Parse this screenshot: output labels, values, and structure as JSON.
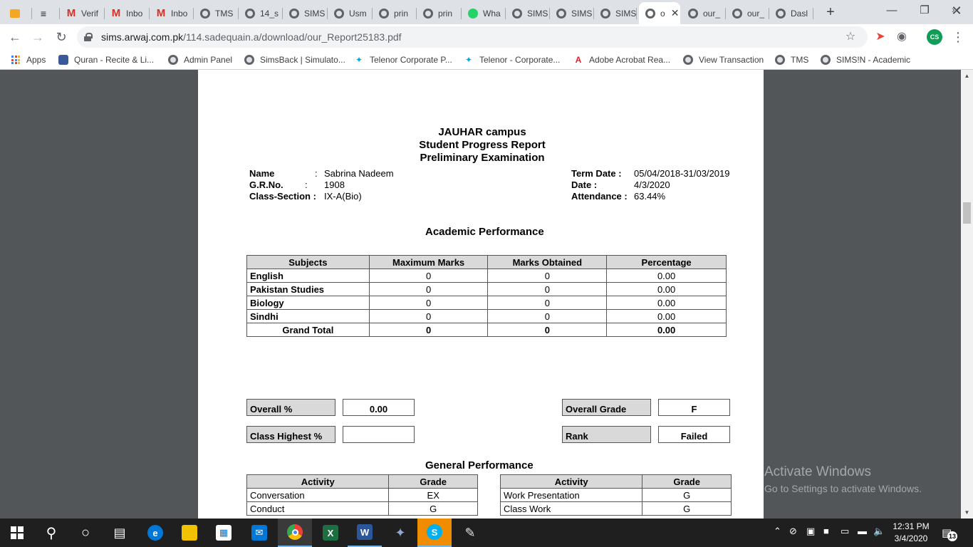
{
  "browser": {
    "tabs": [
      {
        "label": "",
        "icon": "brand-icon"
      },
      {
        "label": "",
        "icon": "sims-icon"
      },
      {
        "label": "Verif",
        "icon": "gmail-icon"
      },
      {
        "label": "Inbo",
        "icon": "gmail-icon"
      },
      {
        "label": "Inbo",
        "icon": "gmail-icon"
      },
      {
        "label": "TMS",
        "icon": "globe-icon"
      },
      {
        "label": "14_s",
        "icon": "globe-icon"
      },
      {
        "label": "SIMS",
        "icon": "globe-icon"
      },
      {
        "label": "Usm",
        "icon": "globe-icon"
      },
      {
        "label": "prin",
        "icon": "globe-icon"
      },
      {
        "label": "prin",
        "icon": "globe-icon"
      },
      {
        "label": "Wha",
        "icon": "whatsapp-icon"
      },
      {
        "label": "SIMS",
        "icon": "globe-icon"
      },
      {
        "label": "SIMS",
        "icon": "globe-icon"
      },
      {
        "label": "SIMS",
        "icon": "globe-icon"
      },
      {
        "label": "o",
        "icon": "globe-icon",
        "active": true
      },
      {
        "label": "our_",
        "icon": "globe-icon"
      },
      {
        "label": "our_",
        "icon": "globe-icon"
      },
      {
        "label": "Dasl",
        "icon": "globe-icon"
      }
    ],
    "url_host": "sims.arwaj.com.pk",
    "url_path": "/114.sadequain.a/download/our_Report25183.pdf",
    "profile_initials": "CS",
    "bookmarks": [
      {
        "label": "Apps",
        "icon": "apps-grid-icon"
      },
      {
        "label": "Quran - Recite & Li...",
        "icon": "quran-icon"
      },
      {
        "label": "Admin Panel",
        "icon": "globe-icon"
      },
      {
        "label": "SimsBack | Simulato...",
        "icon": "globe-icon"
      },
      {
        "label": "Telenor Corporate P...",
        "icon": "telenor-icon"
      },
      {
        "label": "Telenor - Corporate...",
        "icon": "telenor-icon"
      },
      {
        "label": "Adobe Acrobat Rea...",
        "icon": "adobe-icon"
      },
      {
        "label": "View Transaction",
        "icon": "globe-icon"
      },
      {
        "label": "TMS",
        "icon": "globe-icon"
      },
      {
        "label": "SIMS!N - Academic",
        "icon": "globe-icon"
      }
    ]
  },
  "report": {
    "campus": "JAUHAR campus",
    "title": "Student Progress Report",
    "exam": "Preliminary Examination",
    "name_label": "Name",
    "name_sep": ":",
    "name_value": "Sabrina Nadeem",
    "gr_label": "G.R.No.",
    "gr_sep": ":",
    "gr_value": "1908",
    "class_label": "Class-Section :",
    "class_value": "IX-A(Bio)",
    "term_label": "Term Date :",
    "term_value": "05/04/2018-31/03/2019",
    "date_label": "Date :",
    "date_value": "4/3/2020",
    "att_label": "Attendance :",
    "att_value": "63.44%",
    "academic_heading": "Academic Performance",
    "academic_headers": [
      "Subjects",
      "Maximum Marks",
      "Marks Obtained",
      "Percentage"
    ],
    "academic_rows": [
      [
        "English",
        "0",
        "0",
        "0.00"
      ],
      [
        "Pakistan Studies",
        "0",
        "0",
        "0.00"
      ],
      [
        "Biology",
        "0",
        "0",
        "0.00"
      ],
      [
        "Sindhi",
        "0",
        "0",
        "0.00"
      ]
    ],
    "total_row": [
      "Grand Total",
      "0",
      "0",
      "0.00"
    ],
    "overall_pct_label": "Overall %",
    "overall_pct_value": "0.00",
    "class_highest_label": "Class Highest %",
    "class_highest_value": "",
    "overall_grade_label": "Overall Grade",
    "overall_grade_value": "F",
    "rank_label": "Rank",
    "rank_value": "Failed",
    "general_heading": "General Performance",
    "gen_headers": [
      "Activity",
      "Grade"
    ],
    "gen_left": [
      [
        "Conversation",
        "EX"
      ],
      [
        "Conduct",
        "G"
      ]
    ],
    "gen_right": [
      [
        "Work Presentation",
        "G"
      ],
      [
        "Class Work",
        "G"
      ]
    ]
  },
  "watermark": {
    "title": "Activate Windows",
    "subtitle": "Go to Settings to activate Windows."
  },
  "taskbar": {
    "time": "12:31 PM",
    "date": "3/4/2020",
    "notification_count": "13"
  }
}
